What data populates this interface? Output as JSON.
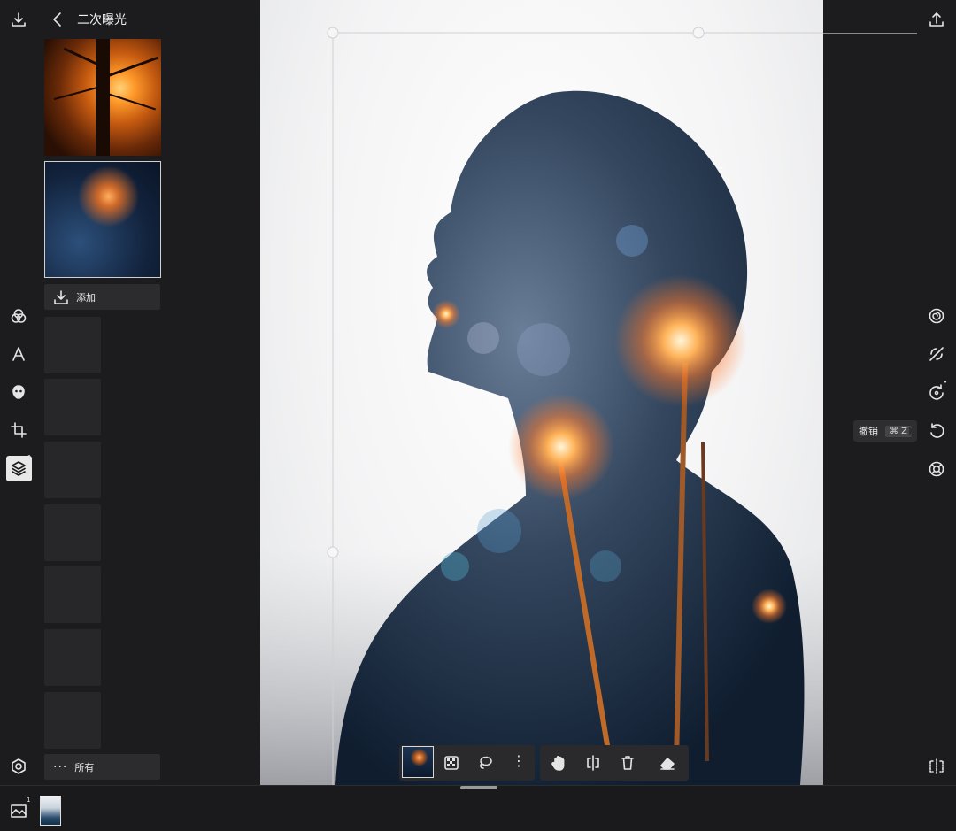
{
  "header": {
    "title": "二次曝光",
    "icons": [
      "download-icon",
      "back-chevron-icon",
      "share-upload-icon"
    ]
  },
  "left_panel": {
    "add_label": "添加",
    "all_label": "所有",
    "more_glyph": "···"
  },
  "left_tools": [
    "blend-circles-icon",
    "text-icon",
    "mask-icon",
    "crop-icon",
    "layers-icon",
    "settings-icon"
  ],
  "layers_badge": "1",
  "right_tools": [
    "spiral-icon",
    "heal-icon",
    "redo-arrow-icon",
    "undo-icon",
    "lifebuoy-icon",
    "compare-icon"
  ],
  "tooltip": {
    "label": "撤销",
    "shortcut": "⌘ Z"
  },
  "bottom_toolbar": [
    "layer-thumbnail",
    "opacity-checker-icon",
    "lasso-icon",
    "more-vertical-icon",
    "hand-icon",
    "flip-icon",
    "trash-icon",
    "eraser-icon"
  ],
  "more_vertical_glyph": "⋮",
  "filmstrip": {
    "badge": "1"
  }
}
